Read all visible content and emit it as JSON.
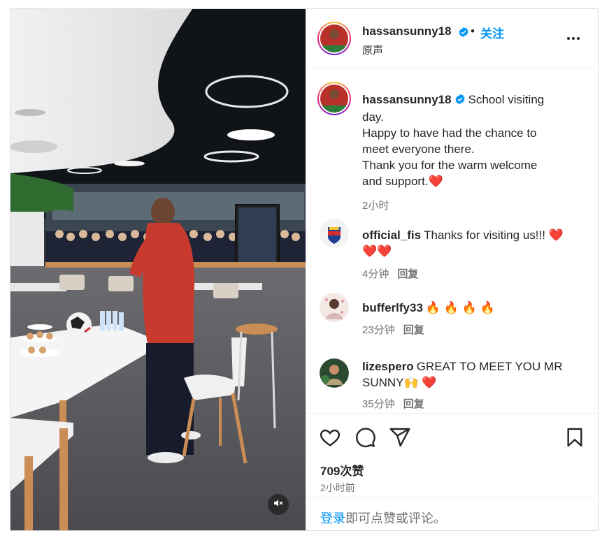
{
  "post": {
    "author": {
      "username": "hassansunny18",
      "verified": true,
      "audio_label": "原声",
      "follow_label": "关注",
      "separator": "•"
    },
    "caption": {
      "username": "hassansunny18",
      "text": "School visiting day.\nHappy to have had the chance to meet everyone there.\nThank you for the warm welcome and support.❤️",
      "line1": "School visiting",
      "line2": "day.",
      "line3": "Happy to have had the chance to",
      "line4": "meet everyone there.",
      "line5": "Thank you for the warm welcome",
      "line6": "and support.❤️",
      "time": "2小时"
    },
    "comments": [
      {
        "username": "official_fis",
        "text_line1": "Thanks for visiting us!!! ❤️",
        "text_line2": "❤️❤️",
        "time": "4分钟",
        "reply_label": "回复"
      },
      {
        "username": "bufferlfy33",
        "text_line1": "🔥 🔥 🔥 🔥",
        "time": "23分钟",
        "reply_label": "回复"
      },
      {
        "username": "lizespero",
        "text_line1": "GREAT TO MEET YOU MR",
        "text_line2": "SUNNY🙌 ❤️",
        "time": "35分钟",
        "reply_label": "回复"
      }
    ],
    "likes": "709次赞",
    "posted_time": "2小时前",
    "login_prompt": {
      "link": "登录",
      "rest": "即可点赞或评论。"
    }
  },
  "icons": {
    "like": "heart-icon",
    "comment": "comment-bubble-icon",
    "share": "paper-plane-icon",
    "save": "bookmark-icon",
    "more": "more-horizontal-icon",
    "mute": "speaker-muted-icon",
    "verified": "verified-badge-icon"
  },
  "colors": {
    "accent": "#0095f6",
    "verified": "#0095f6",
    "heart": "#ed4956",
    "text": "#262626",
    "secondary": "#737373",
    "border": "#dbdbdb"
  }
}
